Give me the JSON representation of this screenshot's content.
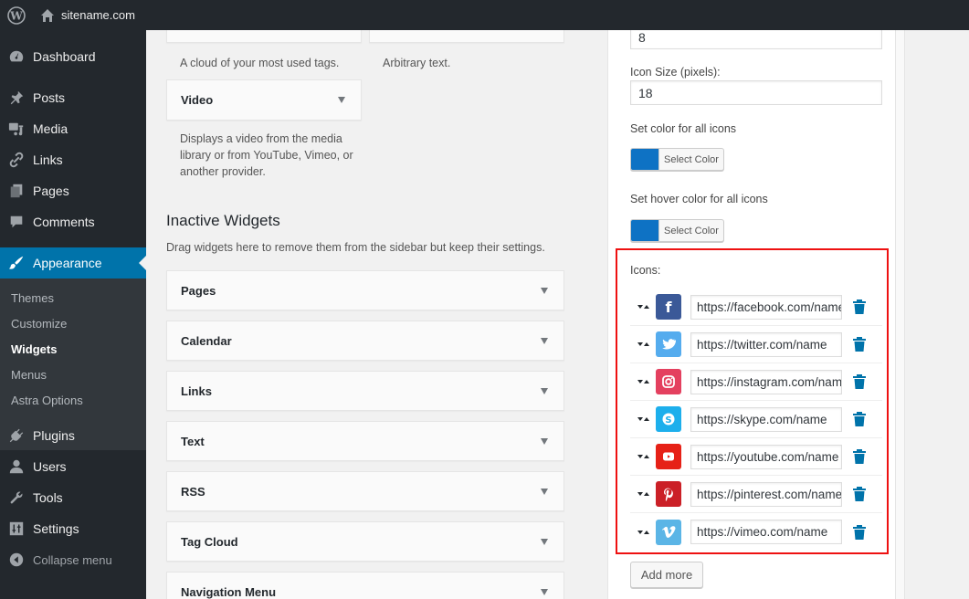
{
  "adminbar": {
    "logo_icon": "wordpress-logo-icon",
    "home_icon": "home-icon",
    "site_name": "sitename.com"
  },
  "sidebar": {
    "items": [
      {
        "label": "Dashboard",
        "icon": "dashboard-icon"
      },
      {
        "label": "Posts",
        "icon": "pin-icon"
      },
      {
        "label": "Media",
        "icon": "media-icon"
      },
      {
        "label": "Links",
        "icon": "link-icon"
      },
      {
        "label": "Pages",
        "icon": "pages-icon"
      },
      {
        "label": "Comments",
        "icon": "comment-icon"
      },
      {
        "label": "Appearance",
        "icon": "paintbrush-icon",
        "active": true
      },
      {
        "label": "Plugins",
        "icon": "plugin-icon"
      },
      {
        "label": "Users",
        "icon": "user-icon"
      },
      {
        "label": "Tools",
        "icon": "wrench-icon"
      },
      {
        "label": "Settings",
        "icon": "settings-icon"
      }
    ],
    "submenu": [
      {
        "label": "Themes"
      },
      {
        "label": "Customize"
      },
      {
        "label": "Widgets",
        "current": true
      },
      {
        "label": "Menus"
      },
      {
        "label": "Astra Options"
      }
    ],
    "collapse_label": "Collapse menu"
  },
  "available_widgets": {
    "tag_cloud_desc": "A cloud of your most used tags.",
    "text_desc": "Arbitrary text.",
    "video": {
      "title": "Video",
      "desc": "Displays a video from the media library or from YouTube, Vimeo, or another provider."
    }
  },
  "inactive_widgets": {
    "title": "Inactive Widgets",
    "description": "Drag widgets here to remove them from the sidebar but keep their settings.",
    "widgets": [
      "Pages",
      "Calendar",
      "Links",
      "Text",
      "RSS",
      "Tag Cloud",
      "Navigation Menu"
    ]
  },
  "social_widget": {
    "spacing_value": "8",
    "icon_size_label": "Icon Size (pixels):",
    "icon_size_value": "18",
    "color_label": "Set color for all icons",
    "color_button": "Select Color",
    "hover_color_label": "Set hover color for all icons",
    "hover_color_button": "Select Color",
    "selected_color": "#0e72c4",
    "hover_color": "#0e72c4",
    "icons_label": "Icons:",
    "icons": [
      {
        "network": "facebook",
        "url": "https://facebook.com/name",
        "color": "#3b5998",
        "glyph": "f"
      },
      {
        "network": "twitter",
        "url": "https://twitter.com/name",
        "color": "#55acee",
        "glyph": "twitter"
      },
      {
        "network": "instagram",
        "url": "https://instagram.com/name",
        "color": "#e4405f",
        "glyph": "instagram"
      },
      {
        "network": "skype",
        "url": "https://skype.com/name",
        "color": "#1dafec",
        "glyph": "S"
      },
      {
        "network": "youtube",
        "url": "https://youtube.com/name",
        "color": "#e62117",
        "glyph": "youtube"
      },
      {
        "network": "pinterest",
        "url": "https://pinterest.com/name",
        "color": "#cb2027",
        "glyph": "P"
      },
      {
        "network": "vimeo",
        "url": "https://vimeo.com/name",
        "color": "#5bb5e6",
        "glyph": "v"
      }
    ],
    "add_more": "Add more"
  }
}
